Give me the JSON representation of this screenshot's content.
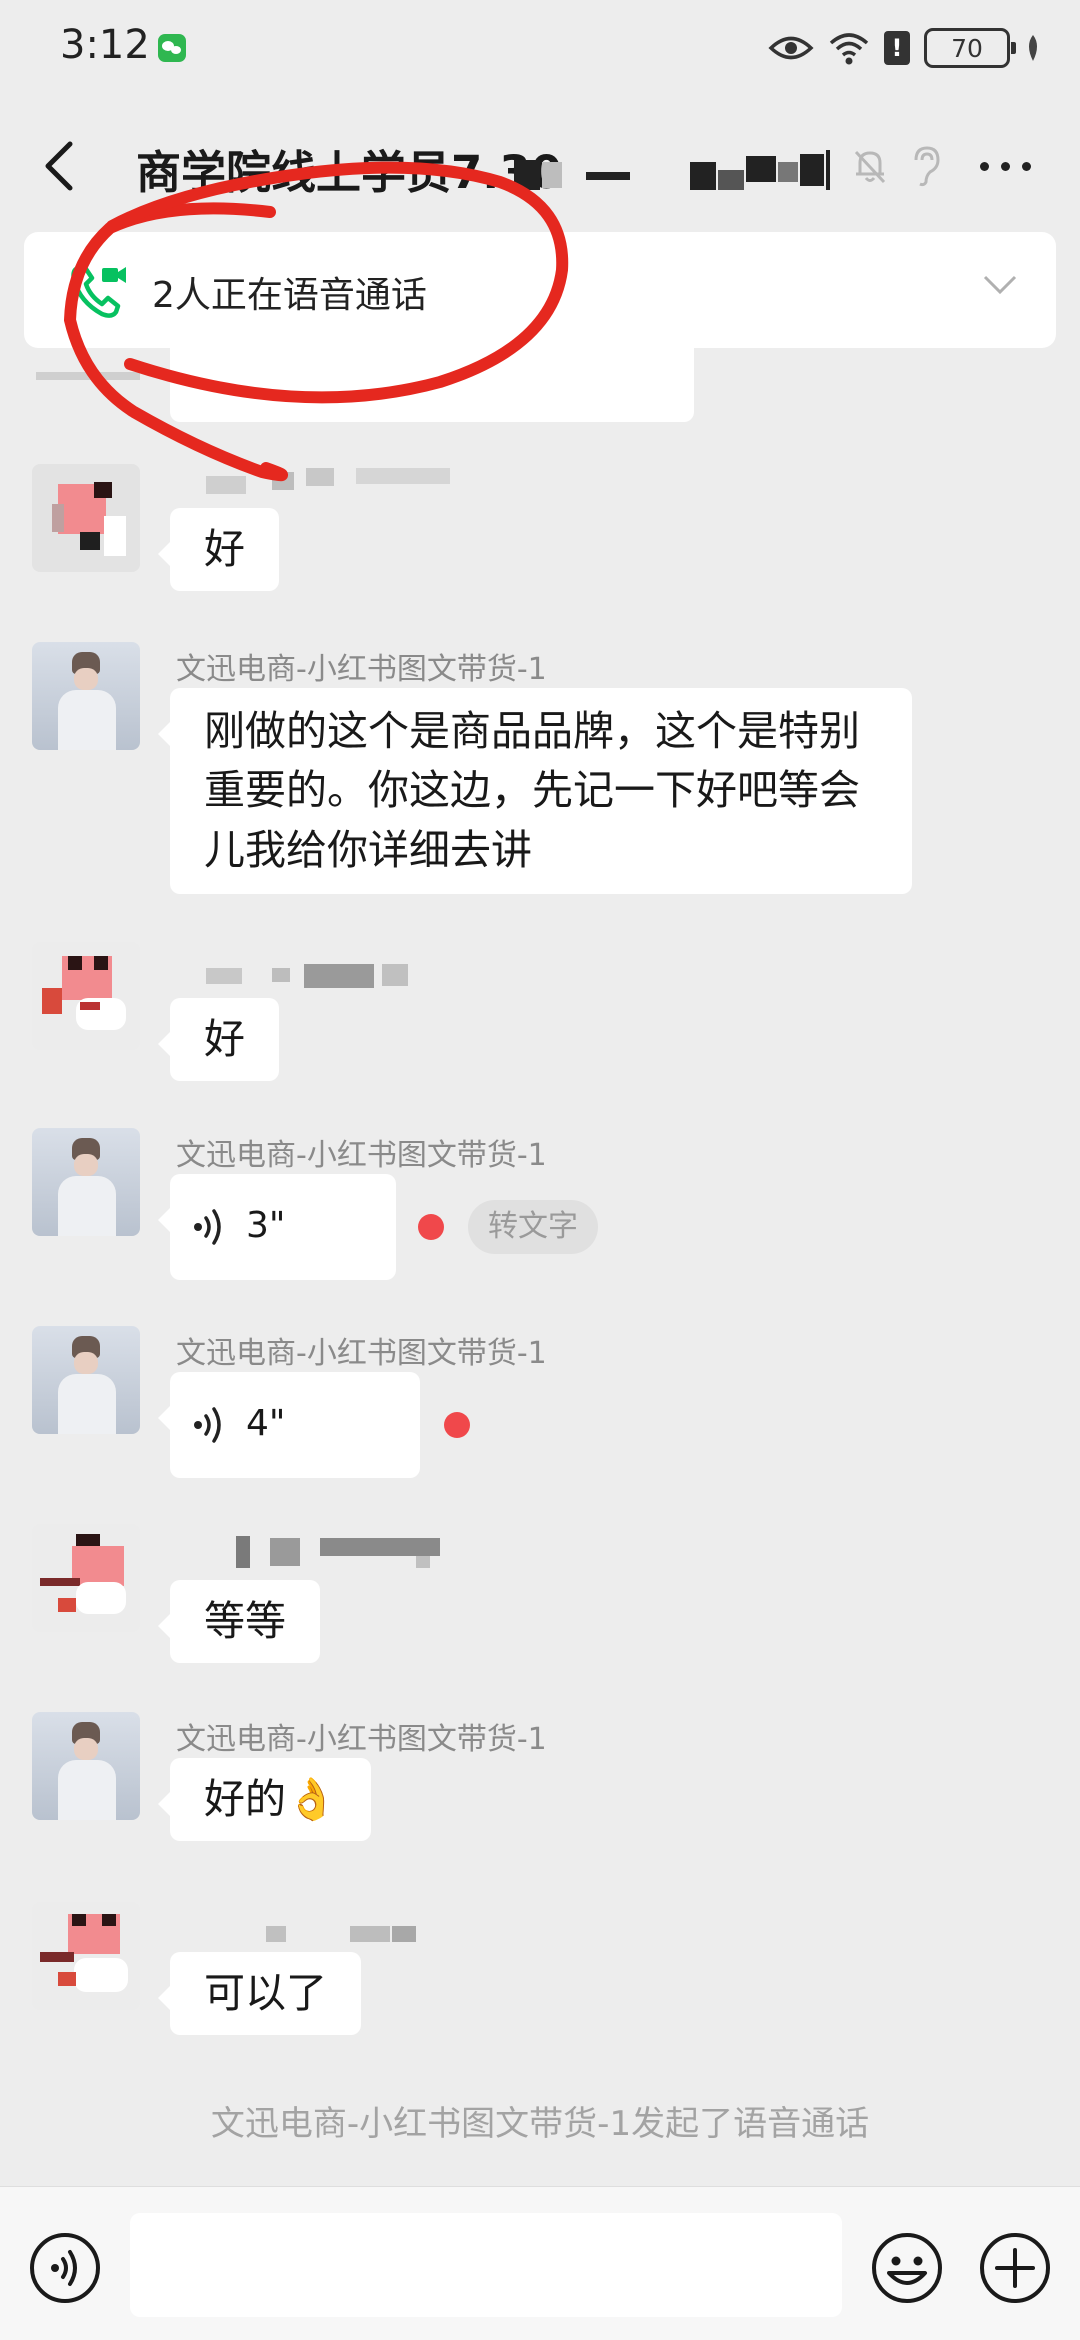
{
  "status_bar": {
    "time": "3:12",
    "battery": "70"
  },
  "header": {
    "title": "商学院线上学员7.30"
  },
  "call_banner": {
    "text": "2人正在语音通话"
  },
  "messages": [
    {
      "sender": "文迅电商-小红书图文带货-1",
      "text": "刚做的这个是商品品牌，这个是特别重要的。你这边，先记一下好吧等会儿我给你详细去讲"
    },
    {
      "text": "好"
    },
    {
      "text": "好"
    },
    {
      "sender": "文迅电商-小红书图文带货-1",
      "voice_duration": "3\"",
      "to_text_label": "转文字"
    },
    {
      "sender": "文迅电商-小红书图文带货-1",
      "voice_duration": "4\""
    },
    {
      "text": "等等"
    },
    {
      "sender": "文迅电商-小红书图文带货-1",
      "text": "好的👌"
    },
    {
      "text": "可以了"
    }
  ],
  "system_note": "文迅电商-小红书图文带货-1发起了语音通话",
  "colors": {
    "accent_green": "#07c160",
    "unread_red": "#f0484b",
    "annotation_red": "#e5281f"
  }
}
